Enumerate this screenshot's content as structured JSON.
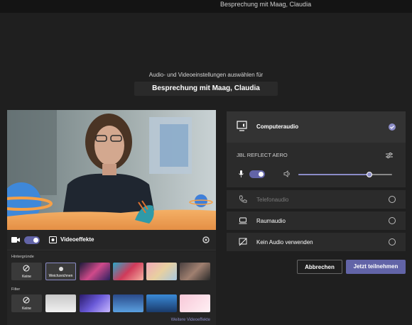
{
  "window": {
    "title": "Besprechung mit Maag, Claudia"
  },
  "header": {
    "subtitle": "Audio- und Videoeinstellungen auswählen für",
    "meeting_title": "Besprechung mit Maag, Claudia"
  },
  "video": {
    "camera_on": true,
    "effects_label": "Videoeffekte"
  },
  "backgrounds": {
    "label": "Hintergründe",
    "items": [
      {
        "label": "Keine",
        "selected": false
      },
      {
        "label": "Weichzeichnen",
        "selected": true
      },
      {
        "label": "",
        "selected": false
      },
      {
        "label": "",
        "selected": false
      },
      {
        "label": "",
        "selected": false
      },
      {
        "label": "",
        "selected": false
      }
    ]
  },
  "filters": {
    "label": "Filter",
    "items": [
      {
        "label": "Keine"
      },
      {
        "label": ""
      },
      {
        "label": ""
      },
      {
        "label": ""
      },
      {
        "label": ""
      },
      {
        "label": ""
      }
    ],
    "more_link": "Weitere Videoeffekte"
  },
  "audio": {
    "computer_audio": "Computeraudio",
    "device_name": "JBL REFLECT AERO",
    "mic_on": true,
    "volume_level": 0.76,
    "options": [
      {
        "label": "Telefonaudio",
        "disabled": true
      },
      {
        "label": "Raumaudio",
        "disabled": false
      },
      {
        "label": "Kein Audio verwenden",
        "disabled": false
      }
    ]
  },
  "actions": {
    "cancel_label": "Abbrechen",
    "join_label": "Jetzt teilnehmen"
  },
  "colors": {
    "accent": "#6264a7",
    "background": "#1f1f1f"
  }
}
